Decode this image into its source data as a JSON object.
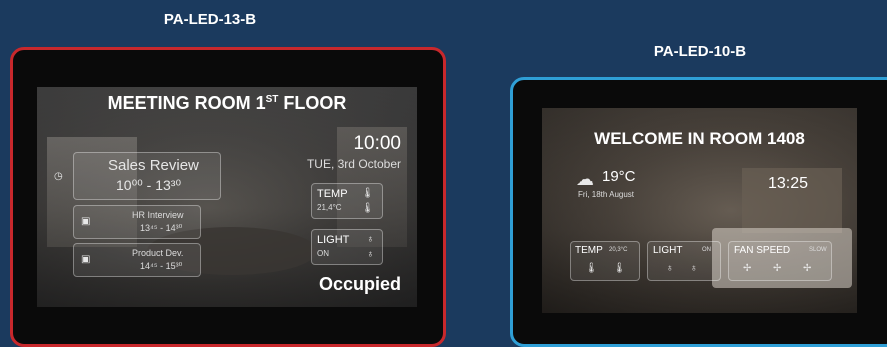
{
  "devices": [
    {
      "label": "PA-LED-13-B",
      "title_main": "MEETING ROOM 1",
      "title_sup": "ST",
      "title_end": " FLOOR",
      "time": "10:00",
      "date": "TUE, 3rd October",
      "meeting": {
        "name": "Sales Review",
        "time": "10⁰⁰ - 13³⁰"
      },
      "upcoming": [
        {
          "name": "HR Interview",
          "time": "13⁴⁵ - 14³⁰"
        },
        {
          "name": "Product Dev.",
          "time": "14⁴⁵ - 15³⁰"
        }
      ],
      "temp": {
        "label": "TEMP",
        "value": "21,4°C"
      },
      "light": {
        "label": "LIGHT",
        "value": "ON"
      },
      "status": "Occupied",
      "border_color": "#c8282c"
    },
    {
      "label": "PA-LED-10-B",
      "title": "WELCOME IN ROOM 1408",
      "weather": {
        "temp": "19°C",
        "date": "Fri, 18th August"
      },
      "time": "13:25",
      "temp": {
        "label": "TEMP",
        "value": "20,3°C"
      },
      "light": {
        "label": "LIGHT",
        "value": "ON"
      },
      "fan": {
        "label": "FAN SPEED",
        "value": "SLOW"
      },
      "border_color": "#2f9fd6"
    }
  ],
  "icons": [
    "clock-icon",
    "calendar-icon",
    "thermometer-icon",
    "bulb-icon",
    "cloud-sun-icon",
    "fan-icon"
  ]
}
